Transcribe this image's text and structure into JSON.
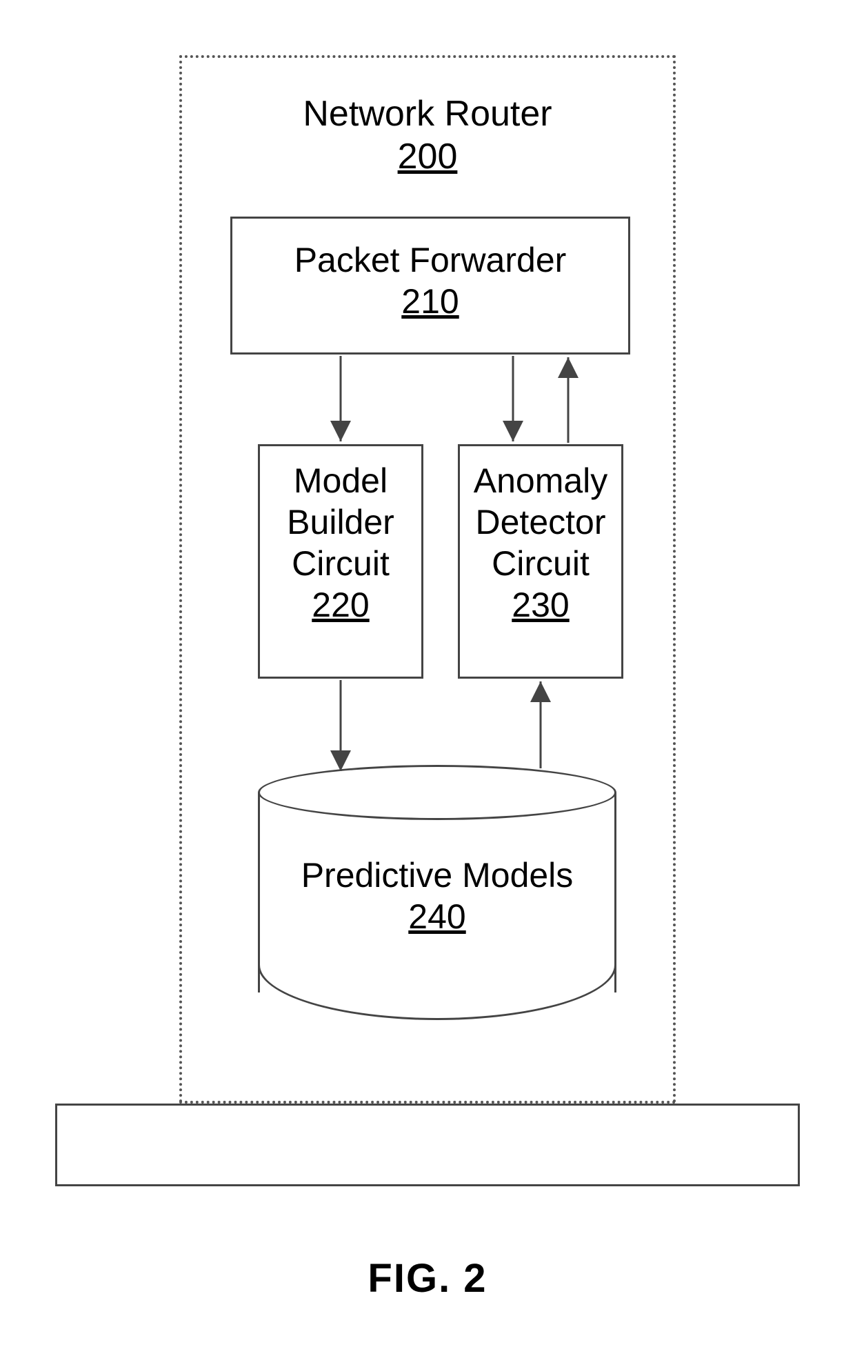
{
  "router": {
    "title": "Network Router",
    "ref": "200"
  },
  "packet_forwarder": {
    "title": "Packet Forwarder",
    "ref": "210"
  },
  "model_builder": {
    "line1": "Model",
    "line2": "Builder",
    "line3": "Circuit",
    "ref": "220"
  },
  "anomaly_detector": {
    "line1": "Anomaly",
    "line2": "Detector",
    "line3": "Circuit",
    "ref": "230"
  },
  "predictive_models": {
    "title": "Predictive Models",
    "ref": "240"
  },
  "figure_caption": "FIG. 2",
  "arrows": [
    {
      "from": "packet_forwarder",
      "to": "model_builder",
      "bidirectional": false
    },
    {
      "from": "packet_forwarder",
      "to": "anomaly_detector",
      "bidirectional": true
    },
    {
      "from": "model_builder",
      "to": "predictive_models",
      "bidirectional": false
    },
    {
      "from": "predictive_models",
      "to": "anomaly_detector",
      "bidirectional": false
    }
  ]
}
